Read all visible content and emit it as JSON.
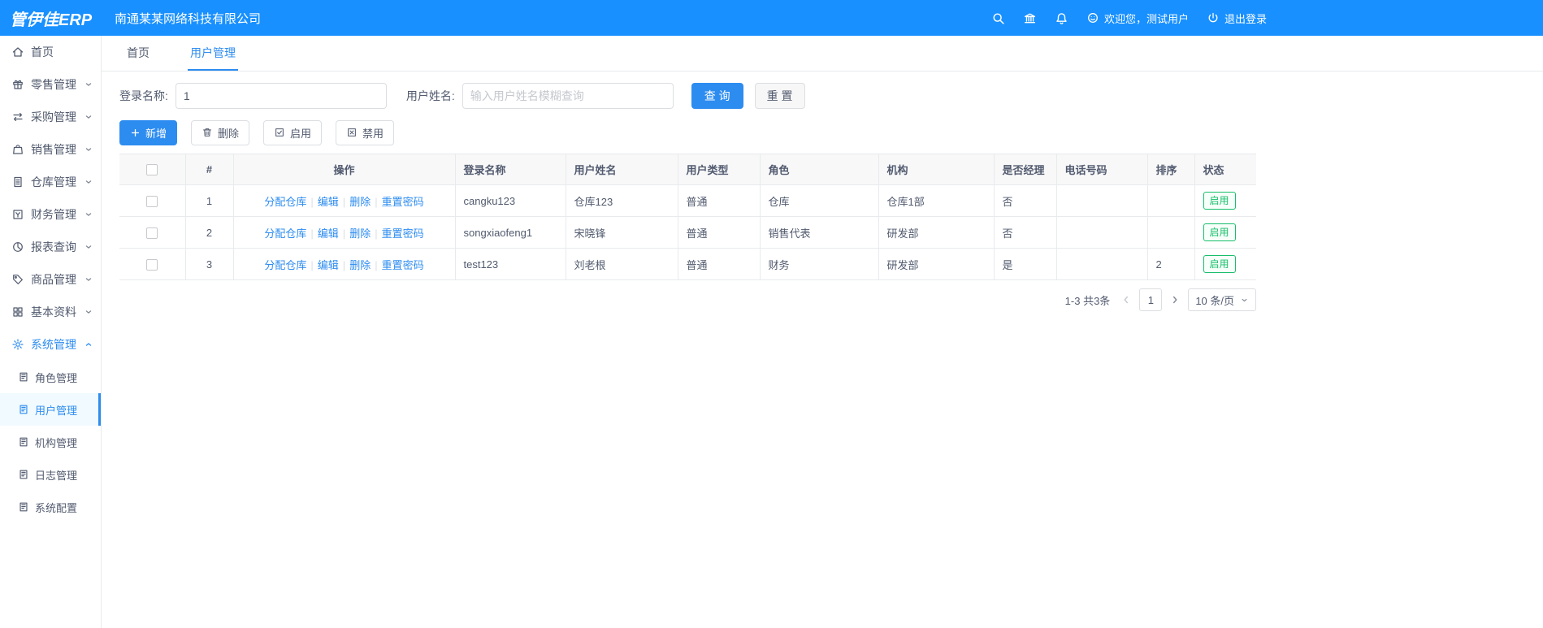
{
  "topbar": {
    "logo": "管伊佳ERP",
    "company": "南通某某网络科技有限公司",
    "welcome": "欢迎您，测试用户",
    "logout": "退出登录"
  },
  "sidebar": {
    "items": [
      {
        "label": "首页"
      },
      {
        "label": "零售管理"
      },
      {
        "label": "采购管理"
      },
      {
        "label": "销售管理"
      },
      {
        "label": "仓库管理"
      },
      {
        "label": "财务管理"
      },
      {
        "label": "报表查询"
      },
      {
        "label": "商品管理"
      },
      {
        "label": "基本资料"
      },
      {
        "label": "系统管理"
      }
    ],
    "system_children": [
      {
        "label": "角色管理"
      },
      {
        "label": "用户管理"
      },
      {
        "label": "机构管理"
      },
      {
        "label": "日志管理"
      },
      {
        "label": "系统配置"
      }
    ]
  },
  "tabs": {
    "home": "首页",
    "current": "用户管理"
  },
  "filters": {
    "login_label": "登录名称:",
    "login_value": "1",
    "name_label": "用户姓名:",
    "name_placeholder": "输入用户姓名模糊查询",
    "search_button": "查 询",
    "reset_button": "重 置"
  },
  "toolbar": {
    "add": "新增",
    "delete": "删除",
    "enable": "启用",
    "disable": "禁用"
  },
  "table": {
    "headers": {
      "index": "#",
      "action": "操作",
      "login": "登录名称",
      "name": "用户姓名",
      "type": "用户类型",
      "role": "角色",
      "org": "机构",
      "manager": "是否经理",
      "phone": "电话号码",
      "sort": "排序",
      "status": "状态"
    },
    "actions": {
      "assign": "分配仓库",
      "edit": "编辑",
      "del": "删除",
      "reset_pwd": "重置密码",
      "separator": "|"
    },
    "rows": [
      {
        "index": "1",
        "login": "cangku123",
        "name": "仓库123",
        "type": "普通",
        "role": "仓库",
        "org": "仓库1部",
        "manager": "否",
        "phone": "",
        "sort": "",
        "status": "启用"
      },
      {
        "index": "2",
        "login": "songxiaofeng1",
        "name": "宋晓锋",
        "type": "普通",
        "role": "销售代表",
        "org": "研发部",
        "manager": "否",
        "phone": "",
        "sort": "",
        "status": "启用"
      },
      {
        "index": "3",
        "login": "test123",
        "name": "刘老根",
        "type": "普通",
        "role": "财务",
        "org": "研发部",
        "manager": "是",
        "phone": "",
        "sort": "2",
        "status": "启用"
      }
    ]
  },
  "pagination": {
    "total": "1-3 共3条",
    "current_page": "1",
    "page_size": "10 条/页"
  },
  "colors": {
    "topbar": "#1890ff",
    "primary": "#2d8cf0",
    "success": "#19be6b"
  }
}
